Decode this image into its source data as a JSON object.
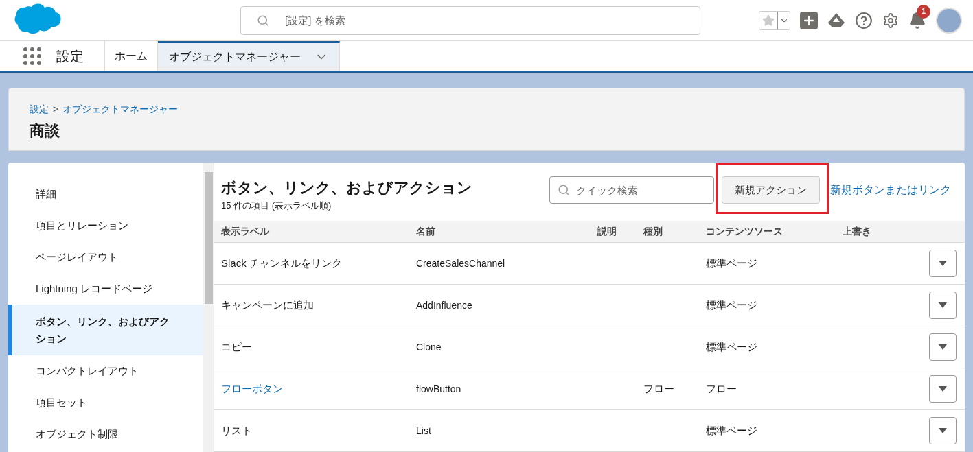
{
  "header": {
    "search_placeholder": "[設定] を検索",
    "notifications": "1"
  },
  "nav": {
    "app_name": "設定",
    "tabs": [
      {
        "label": "ホーム",
        "selected": false,
        "dropdown": false
      },
      {
        "label": "オブジェクトマネージャー",
        "selected": true,
        "dropdown": true
      }
    ]
  },
  "page_header": {
    "breadcrumb": [
      "設定",
      "オブジェクトマネージャー"
    ],
    "separator": ">",
    "title": "商談"
  },
  "sidebar": {
    "items": [
      {
        "label": "詳細",
        "selected": false
      },
      {
        "label": "項目とリレーション",
        "selected": false
      },
      {
        "label": "ページレイアウト",
        "selected": false
      },
      {
        "label": "Lightning レコードページ",
        "selected": false
      },
      {
        "label": "ボタン、リンク、およびアクション",
        "selected": true
      },
      {
        "label": "コンパクトレイアウト",
        "selected": false
      },
      {
        "label": "項目セット",
        "selected": false
      },
      {
        "label": "オブジェクト制限",
        "selected": false
      }
    ]
  },
  "content": {
    "title": "ボタン、リンク、およびアクション",
    "subtitle": "15 件の項目 (表示ラベル順)",
    "search_placeholder": "クイック検索",
    "buttons": [
      {
        "label": "新規アクション",
        "kind": "neutral",
        "highlighted": true
      },
      {
        "label": "新規ボタンまたはリンク",
        "kind": "link",
        "highlighted": false
      }
    ]
  },
  "table": {
    "columns": [
      "表示ラベル",
      "名前",
      "説明",
      "種別",
      "コンテンツソース",
      "上書き"
    ],
    "rows": [
      {
        "label": "Slack チャンネルをリンク",
        "link": false,
        "name": "CreateSalesChannel",
        "type": "",
        "source": "標準ページ"
      },
      {
        "label": "キャンペーンに追加",
        "link": false,
        "name": "AddInfluence",
        "type": "",
        "source": "標準ページ"
      },
      {
        "label": "コピー",
        "link": false,
        "name": "Clone",
        "type": "",
        "source": "標準ページ"
      },
      {
        "label": "フローボタン",
        "link": true,
        "name": "flowButton",
        "type": "フロー",
        "source": "フロー"
      },
      {
        "label": "リスト",
        "link": false,
        "name": "List",
        "type": "",
        "source": "標準ページ"
      }
    ]
  }
}
